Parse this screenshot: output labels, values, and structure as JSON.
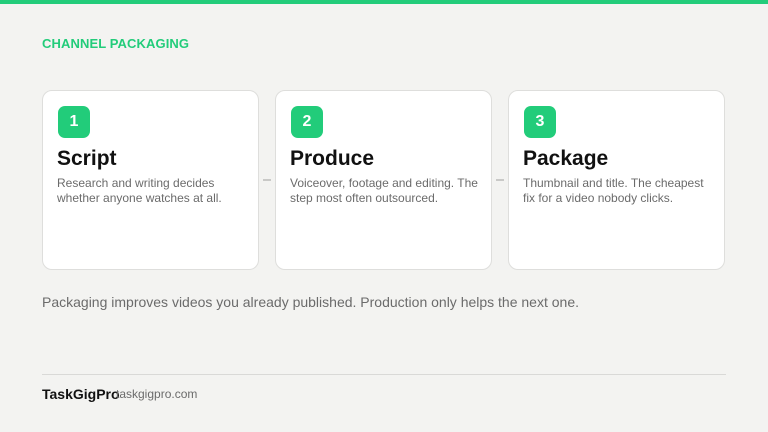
{
  "header": {
    "section_label": "CHANNEL PACKAGING",
    "accent_color": "#22cc7a"
  },
  "steps": [
    {
      "number": "1",
      "title": "Script",
      "description": "Research and writing decides whether anyone watches at all."
    },
    {
      "number": "2",
      "title": "Produce",
      "description": "Voiceover, footage and editing. The step most often outsourced."
    },
    {
      "number": "3",
      "title": "Package",
      "description": "Thumbnail and title. The cheapest fix for a video nobody clicks."
    }
  ],
  "footnote": "Packaging improves videos you already published. Production only helps the next one.",
  "footer": {
    "brand": "TaskGigPro",
    "site": "taskgigpro.com"
  }
}
